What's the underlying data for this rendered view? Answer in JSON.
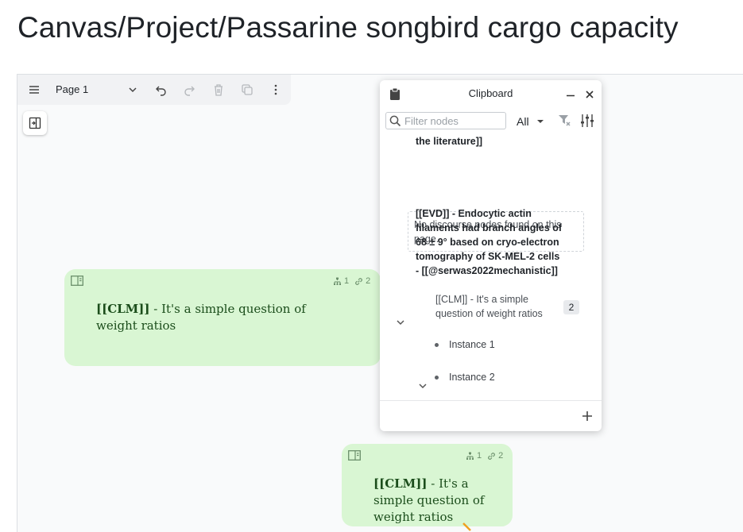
{
  "page_title": "Canvas/Project/Passarine songbird cargo capacity",
  "toolbar": {
    "page_name": "Page 1",
    "icons": [
      "menu-icon",
      "chevron-down-icon",
      "undo-icon",
      "redo-icon",
      "trash-icon",
      "duplicate-icon",
      "more-vertical-icon"
    ]
  },
  "nodes": [
    {
      "tag": "[[CLM]]",
      "text": " - It's a simple question of weight ratios",
      "children_count": "1",
      "links_count": "2"
    },
    {
      "tag": "[[CLM]]",
      "text": " - It's a simple question of weight ratios",
      "children_count": "1",
      "links_count": "2"
    }
  ],
  "clipboard": {
    "title": "Clipboard",
    "filter_placeholder": "Filter nodes",
    "filter_type": "All",
    "truncated_item": "the literature]]",
    "empty_message": "No discourse nodes found on this page.",
    "evidence": {
      "lines": [
        "[[EVD]] - Endocytic actin",
        "filaments had branch angles of",
        "68 ± 9° based on cryo-electron",
        "tomography of SK-MEL-2 cells",
        "- [[@serwas2022mechanistic]]"
      ]
    },
    "claim": {
      "lines": [
        "[[CLM]] - It's a simple",
        "question of weight ratios"
      ],
      "count": "2",
      "instances": [
        "Instance 1",
        "Instance 2"
      ]
    }
  },
  "colors": {
    "node_bg": "#d9f6d3",
    "node_text": "#1b4d1b",
    "canvas_bg": "#f9fafb",
    "accent_arrow": "#f0a020"
  }
}
